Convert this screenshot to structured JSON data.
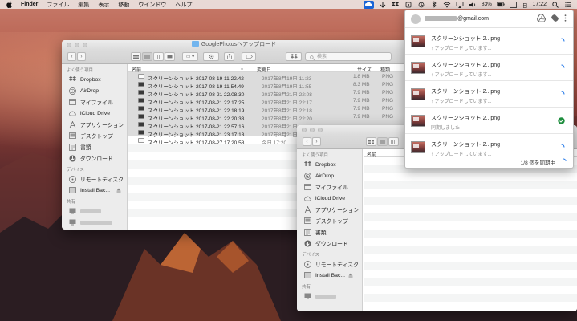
{
  "menubar": {
    "app_name": "Finder",
    "items": [
      "ファイル",
      "編集",
      "表示",
      "移動",
      "ウインドウ",
      "ヘルプ"
    ],
    "battery": "83%",
    "day": "日",
    "time": "17:22"
  },
  "finder_back": {
    "title": "GooglePhotosへアップロード",
    "search_placeholder": "検索",
    "sidebar": {
      "favorites_header": "よく使う項目",
      "favorites": [
        {
          "label": "Dropbox",
          "icon": "dropbox-icon"
        },
        {
          "label": "AirDrop",
          "icon": "airdrop-icon"
        },
        {
          "label": "マイファイル",
          "icon": "all-files-icon"
        },
        {
          "label": "iCloud Drive",
          "icon": "cloud-icon"
        },
        {
          "label": "アプリケーション",
          "icon": "applications-icon"
        },
        {
          "label": "デスクトップ",
          "icon": "desktop-icon"
        },
        {
          "label": "書類",
          "icon": "documents-icon"
        },
        {
          "label": "ダウンロード",
          "icon": "download-icon"
        }
      ],
      "devices_header": "デバイス",
      "devices": [
        {
          "label": "リモートディスク",
          "icon": "remote-disc-icon"
        },
        {
          "label": "Install Bac...",
          "icon": "disk-icon"
        }
      ],
      "shared_header": "共有"
    },
    "columns": {
      "name": "名前",
      "date": "変更日",
      "size": "サイズ",
      "kind": "種類"
    },
    "files": [
      {
        "name": "スクリーンショット 2017-08-19 11.22.42",
        "date": "2017年8月19日 11:23",
        "size": "1.8 MB",
        "kind": "PNG"
      },
      {
        "name": "スクリーンショット 2017-08-19 11.54.49",
        "date": "2017年8月19日 11:55",
        "size": "8.3 MB",
        "kind": "PNG"
      },
      {
        "name": "スクリーンショット 2017-08-21 22.08.30",
        "date": "2017年8月21日 22:08",
        "size": "7.9 MB",
        "kind": "PNG"
      },
      {
        "name": "スクリーンショット 2017-08-21 22.17.25",
        "date": "2017年8月21日 22:17",
        "size": "7.9 MB",
        "kind": "PNG"
      },
      {
        "name": "スクリーンショット 2017-08-21 22.18.19",
        "date": "2017年8月21日 22:18",
        "size": "7.9 MB",
        "kind": "PNG"
      },
      {
        "name": "スクリーンショット 2017-08-21 22.20.33",
        "date": "2017年8月21日 22:20",
        "size": "7.9 MB",
        "kind": "PNG"
      },
      {
        "name": "スクリーンショット 2017-08-21 22.57.16",
        "date": "2017年8月21日",
        "size": "",
        "kind": ""
      },
      {
        "name": "スクリーンショット 2017-08-21 23.17.13",
        "date": "2017年8月21日",
        "size": "",
        "kind": ""
      },
      {
        "name": "スクリーンショット 2017-08-27 17.20.58",
        "date": "今日 17:20",
        "size": "",
        "kind": ""
      }
    ]
  },
  "finder_front": {
    "sidebar": {
      "favorites_header": "よく使う項目",
      "favorites": [
        {
          "label": "Dropbox",
          "icon": "dropbox-icon"
        },
        {
          "label": "AirDrop",
          "icon": "airdrop-icon"
        },
        {
          "label": "マイファイル",
          "icon": "all-files-icon"
        },
        {
          "label": "iCloud Drive",
          "icon": "cloud-icon"
        },
        {
          "label": "アプリケーション",
          "icon": "applications-icon"
        },
        {
          "label": "デスクトップ",
          "icon": "desktop-icon"
        },
        {
          "label": "書類",
          "icon": "documents-icon"
        },
        {
          "label": "ダウンロード",
          "icon": "download-icon"
        }
      ],
      "devices_header": "デバイス",
      "devices": [
        {
          "label": "リモートディスク",
          "icon": "remote-disc-icon"
        },
        {
          "label": "Install Bac...",
          "icon": "disk-icon"
        }
      ],
      "shared_header": "共有"
    },
    "columns": {
      "name": "名前"
    }
  },
  "gdrive": {
    "email": "@gmail.com",
    "items": [
      {
        "name": "スクリーンショット 2...png",
        "status": "↑ アップロードしています...",
        "state": "uploading"
      },
      {
        "name": "スクリーンショット 2...png",
        "status": "↑ アップロードしています...",
        "state": "uploading"
      },
      {
        "name": "スクリーンショット 2...png",
        "status": "↑ アップロードしています...",
        "state": "uploading"
      },
      {
        "name": "スクリーンショット 2...png",
        "status": "同期しました",
        "state": "done"
      },
      {
        "name": "スクリーンショット 2...png",
        "status": "↑ アップロードしています...",
        "state": "uploading"
      }
    ],
    "footer": "1/8 個を同期中",
    "accent": "#1a73e8",
    "done_color": "#1e8e3e"
  }
}
